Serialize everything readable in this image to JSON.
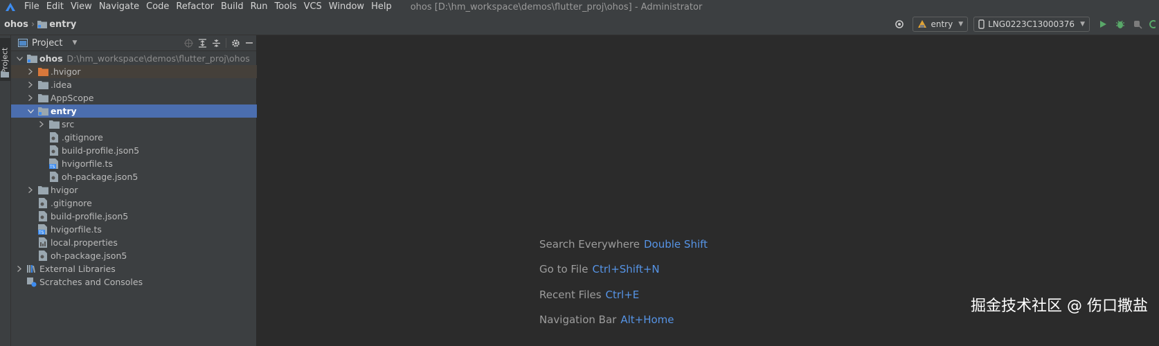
{
  "menubar": {
    "items": [
      "File",
      "Edit",
      "View",
      "Navigate",
      "Code",
      "Refactor",
      "Build",
      "Run",
      "Tools",
      "VCS",
      "Window",
      "Help"
    ],
    "window_title": "ohos [D:\\hm_workspace\\demos\\flutter_proj\\ohos] - Administrator"
  },
  "navbar": {
    "breadcrumb_root": "ohos",
    "breadcrumb_child": "entry",
    "run_config": "entry",
    "device": "LNG0223C13000376"
  },
  "left_strip": {
    "project_tab": "Project"
  },
  "project_panel": {
    "title": "Project",
    "root": {
      "label": "ohos",
      "path": "D:\\hm_workspace\\demos\\flutter_proj\\ohos"
    },
    "items": [
      {
        "label": ".hvigor"
      },
      {
        "label": ".idea"
      },
      {
        "label": "AppScope"
      },
      {
        "label": "entry"
      },
      {
        "label": "src"
      },
      {
        "label": ".gitignore"
      },
      {
        "label": "build-profile.json5"
      },
      {
        "label": "hvigorfile.ts"
      },
      {
        "label": "oh-package.json5"
      },
      {
        "label": "hvigor"
      },
      {
        "label": ".gitignore"
      },
      {
        "label": "build-profile.json5"
      },
      {
        "label": "hvigorfile.ts"
      },
      {
        "label": "local.properties"
      },
      {
        "label": "oh-package.json5"
      },
      {
        "label": "External Libraries"
      },
      {
        "label": "Scratches and Consoles"
      }
    ]
  },
  "editor": {
    "hints": [
      {
        "label": "Search Everywhere",
        "shortcut": "Double Shift"
      },
      {
        "label": "Go to File",
        "shortcut": "Ctrl+Shift+N"
      },
      {
        "label": "Recent Files",
        "shortcut": "Ctrl+E"
      },
      {
        "label": "Navigation Bar",
        "shortcut": "Alt+Home"
      }
    ]
  },
  "watermark": "掘金技术社区 @ 伤口撒盐",
  "colors": {
    "accent_blue": "#4b6eaf",
    "shortcut_blue": "#5694e6",
    "run_green": "#59a869",
    "folder_orange": "#d9783b"
  }
}
